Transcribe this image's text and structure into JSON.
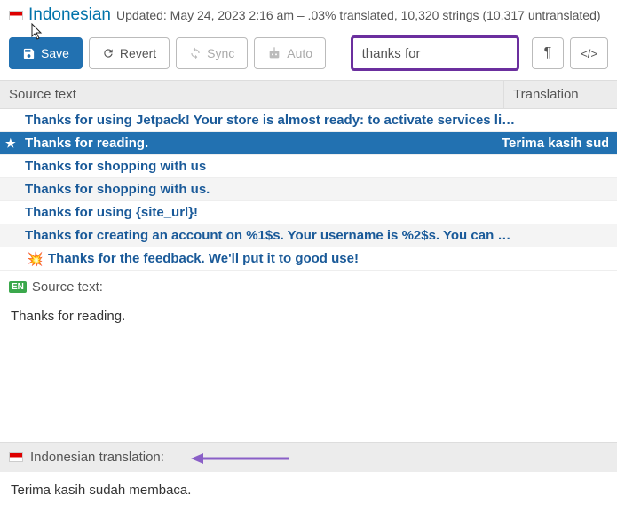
{
  "header": {
    "language": "Indonesian",
    "meta": "Updated: May 24, 2023 2:16 am – .03% translated, 10,320 strings (10,317 untranslated)"
  },
  "toolbar": {
    "save": "Save",
    "revert": "Revert",
    "sync": "Sync",
    "auto": "Auto",
    "search_value": "thanks for"
  },
  "columns": {
    "source": "Source text",
    "translation": "Translation"
  },
  "rows": [
    {
      "text": "Thanks for using Jetpack! Your store is almost ready: to activate services li…",
      "selected": false,
      "alt": false,
      "star": false,
      "spark": false,
      "trans": ""
    },
    {
      "text": "Thanks for reading.",
      "selected": true,
      "alt": false,
      "star": true,
      "spark": false,
      "trans": "Terima kasih sudah m"
    },
    {
      "text": "Thanks for shopping with us",
      "selected": false,
      "alt": false,
      "star": false,
      "spark": false,
      "trans": ""
    },
    {
      "text": "Thanks for shopping with us.",
      "selected": false,
      "alt": true,
      "star": false,
      "spark": false,
      "trans": ""
    },
    {
      "text": "Thanks for using {site_url}!",
      "selected": false,
      "alt": false,
      "star": false,
      "spark": false,
      "trans": ""
    },
    {
      "text": "Thanks for creating an account on %1$s. Your username is %2$s. You can …",
      "selected": false,
      "alt": true,
      "star": false,
      "spark": false,
      "trans": ""
    },
    {
      "text": "Thanks for the feedback. We'll put it to good use!",
      "selected": false,
      "alt": false,
      "star": false,
      "spark": true,
      "trans": ""
    }
  ],
  "source_panel": {
    "label": "Source text:",
    "content": "Thanks for reading."
  },
  "target_panel": {
    "label": "Indonesian translation:",
    "content": "Terima kasih sudah membaca."
  }
}
